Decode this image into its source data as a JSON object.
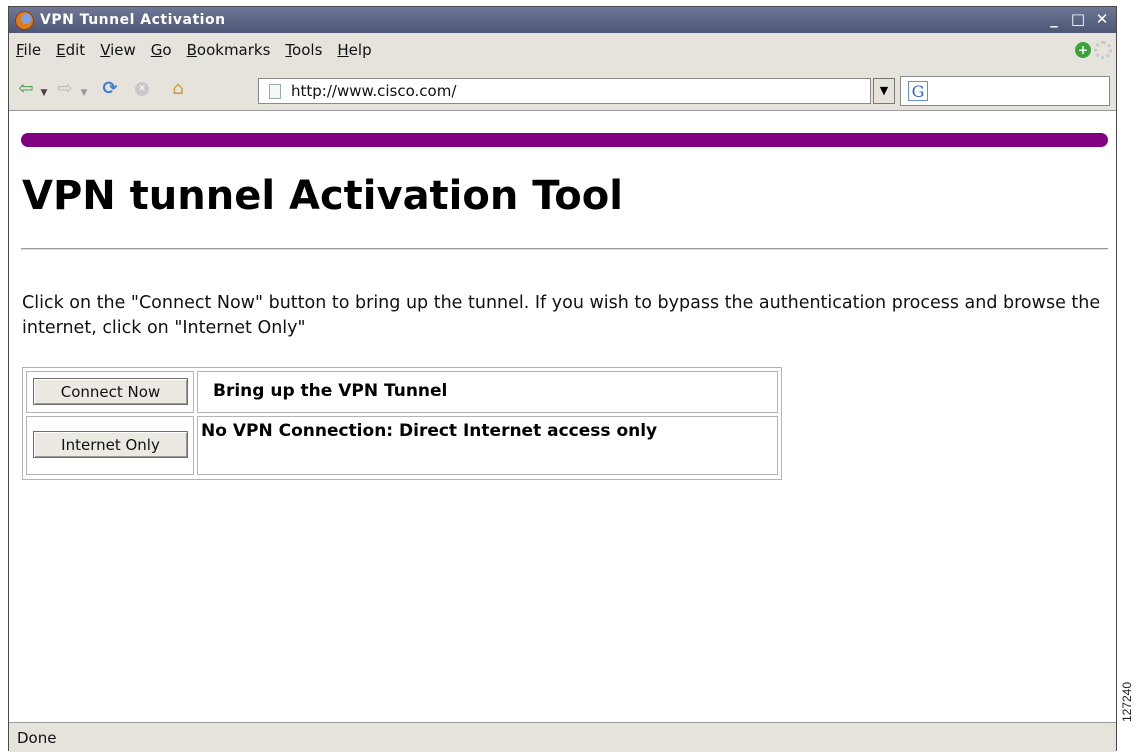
{
  "window": {
    "title": "VPN Tunnel Activation",
    "controls": {
      "minimize": "_",
      "maximize": "□",
      "close": "✕"
    }
  },
  "menubar": {
    "items": [
      {
        "accel": "F",
        "rest": "ile"
      },
      {
        "accel": "E",
        "rest": "dit"
      },
      {
        "accel": "V",
        "rest": "iew"
      },
      {
        "accel": "G",
        "rest": "o"
      },
      {
        "accel": "B",
        "rest": "ookmarks"
      },
      {
        "accel": "T",
        "rest": "ools"
      },
      {
        "accel": "H",
        "rest": "elp"
      }
    ]
  },
  "navbar": {
    "url": "http://www.cisco.com/",
    "search_value": ""
  },
  "page": {
    "title": "VPN tunnel Activation Tool",
    "instructions": "Click on the \"Connect Now\" button to bring up the tunnel. If you wish to bypass the authentication process and browse the internet, click on \"Internet Only\"",
    "accent_color": "#800080",
    "options": [
      {
        "button_label": "Connect Now",
        "description": "Bring up the VPN Tunnel"
      },
      {
        "button_label": "Internet Only",
        "description": " No VPN Connection: Direct Internet access only"
      }
    ]
  },
  "status": {
    "text": "Done"
  },
  "figure_id": "127240"
}
